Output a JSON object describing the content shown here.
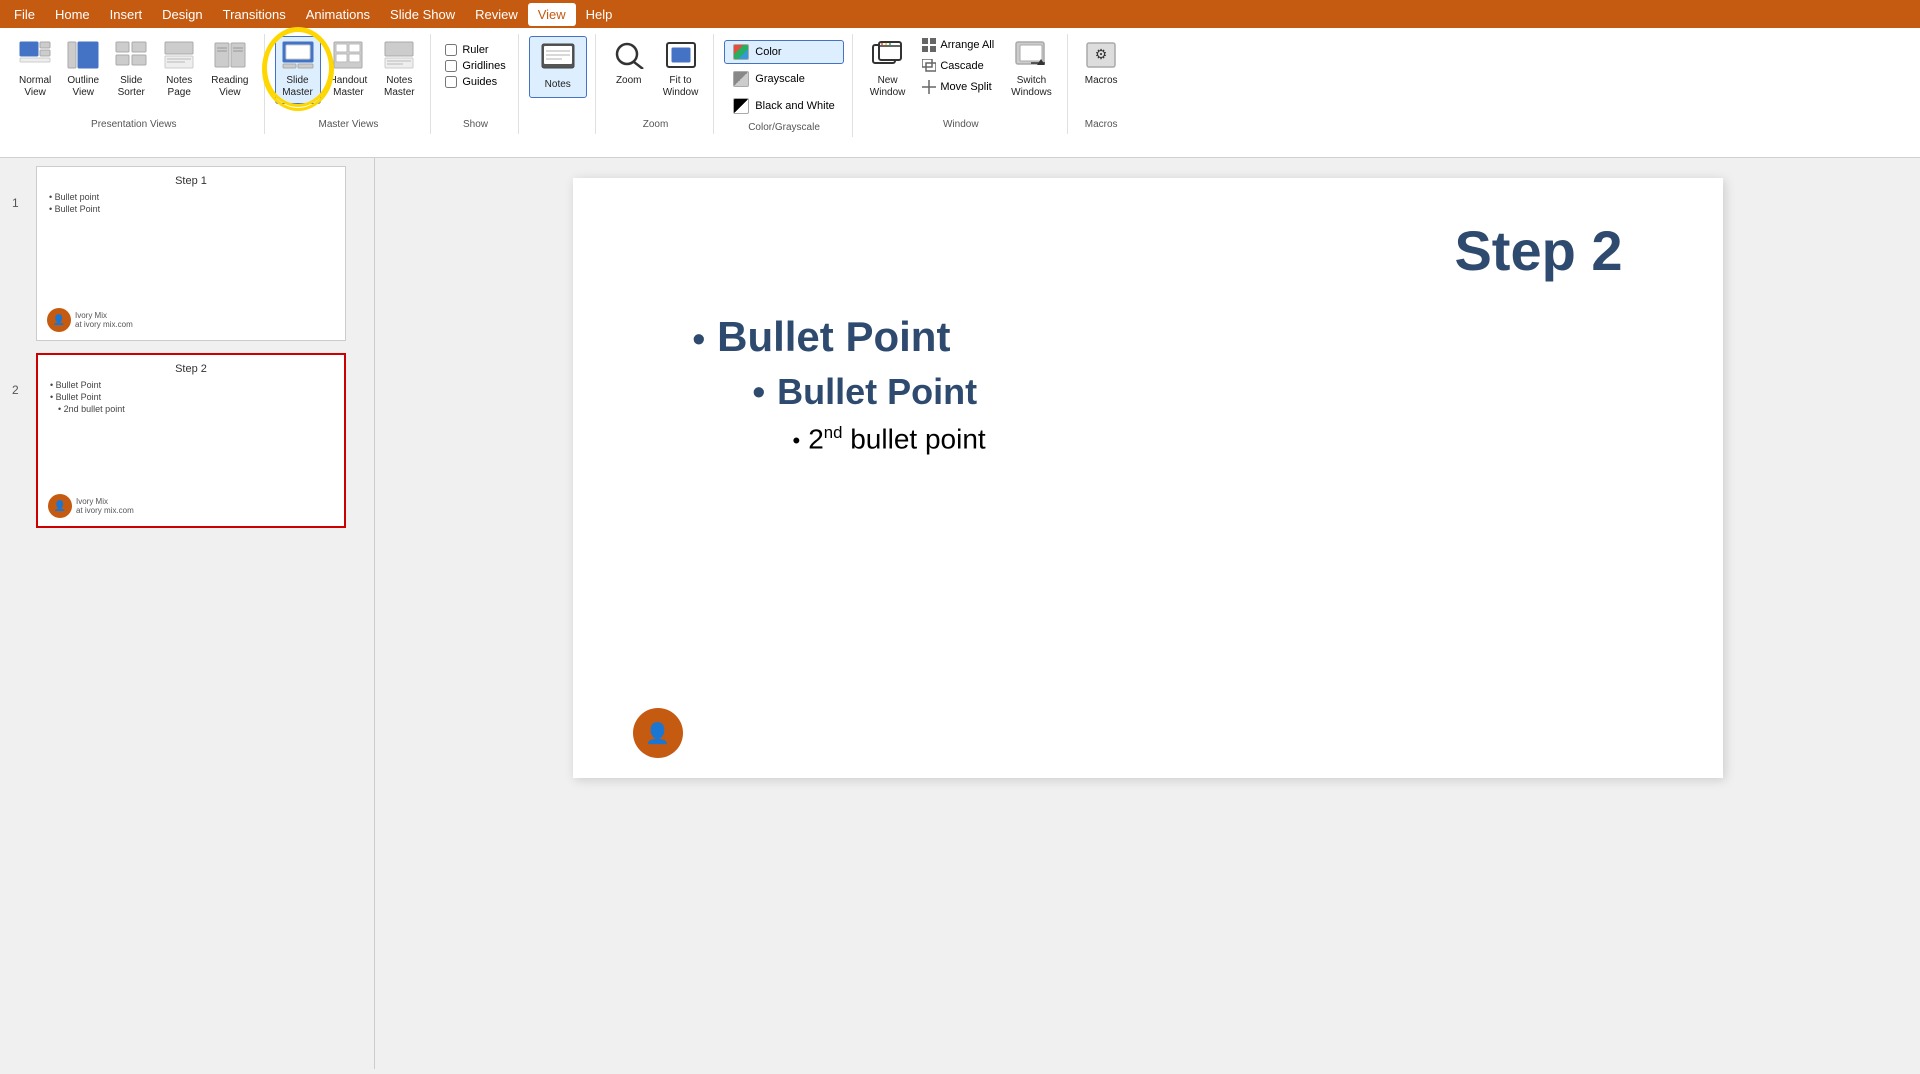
{
  "menubar": {
    "items": [
      "File",
      "Home",
      "Insert",
      "Design",
      "Transitions",
      "Animations",
      "Slide Show",
      "Review",
      "View",
      "Help"
    ],
    "active": "View"
  },
  "ribbon": {
    "groups": [
      {
        "label": "Presentation Views",
        "buttons": [
          {
            "id": "normal",
            "icon": "⊞",
            "label": "Normal\nView",
            "active": false
          },
          {
            "id": "outline",
            "icon": "☰",
            "label": "Outline\nView",
            "active": false
          },
          {
            "id": "slide-sorter",
            "icon": "⊟",
            "label": "Slide\nSorter",
            "active": false
          },
          {
            "id": "notes-page",
            "icon": "📄",
            "label": "Notes\nPage",
            "active": false
          },
          {
            "id": "reading-view",
            "icon": "📖",
            "label": "Reading\nView",
            "active": false
          }
        ]
      },
      {
        "label": "Master Views",
        "buttons": [
          {
            "id": "slide-master",
            "icon": "🖥",
            "label": "Slide\nMaster",
            "active": true,
            "highlighted": true
          },
          {
            "id": "handout-master",
            "icon": "📋",
            "label": "Handout\nMaster",
            "active": false
          },
          {
            "id": "notes-master",
            "icon": "📝",
            "label": "Notes\nMaster",
            "active": false
          }
        ]
      },
      {
        "label": "Show",
        "checkboxes": [
          {
            "id": "ruler",
            "label": "Ruler",
            "checked": false
          },
          {
            "id": "gridlines",
            "label": "Gridlines",
            "checked": false
          },
          {
            "id": "guides",
            "label": "Guides",
            "checked": false
          }
        ]
      },
      {
        "label": "Zoom",
        "buttons": [
          {
            "id": "zoom",
            "icon": "🔍",
            "label": "Zoom",
            "active": false
          },
          {
            "id": "fit-to-window",
            "icon": "⊡",
            "label": "Fit to\nWindow",
            "active": false
          }
        ]
      },
      {
        "label": "Color/Grayscale",
        "colorOptions": [
          {
            "id": "color",
            "label": "Color",
            "swatch": "#e74c3c",
            "active": true
          },
          {
            "id": "grayscale",
            "label": "Grayscale",
            "swatch": "#888888",
            "active": false
          },
          {
            "id": "black-and-white",
            "label": "Black and White",
            "swatch": "#000000",
            "active": false
          }
        ]
      },
      {
        "label": "Window",
        "mainButtons": [
          {
            "id": "new-window",
            "icon": "🪟",
            "label": "New\nWindow"
          },
          {
            "id": "switch-windows",
            "icon": "🔄",
            "label": "Switch\nWindows"
          }
        ],
        "subButtons": [
          {
            "id": "arrange-all",
            "label": "Arrange All"
          },
          {
            "id": "cascade",
            "label": "Cascade"
          },
          {
            "id": "move-split",
            "label": "Move Split"
          }
        ]
      },
      {
        "label": "Macros",
        "buttons": [
          {
            "id": "macros",
            "icon": "⚙",
            "label": "Macros"
          }
        ]
      }
    ],
    "notesButton": {
      "icon": "📝",
      "label": "Notes",
      "active": true
    }
  },
  "slides": [
    {
      "number": "1",
      "title": "Step 1",
      "bullets": [
        "• Bullet point",
        "• Bullet Point"
      ],
      "avatar": "Ivory Mix",
      "selected": false
    },
    {
      "number": "2",
      "title": "Step 2",
      "bullets": [
        "• Bullet Point",
        "• Bullet Point",
        "  • 2nd bullet point"
      ],
      "avatar": "Ivory Mix",
      "selected": true
    }
  ],
  "mainSlide": {
    "title": "Step 2",
    "bullets": [
      {
        "text": "Bullet Point",
        "level": 1
      },
      {
        "text": "Bullet Point",
        "level": 1
      },
      {
        "text": "2nd bullet point",
        "level": 2,
        "superscript": "nd",
        "baseText": "2"
      }
    ]
  }
}
